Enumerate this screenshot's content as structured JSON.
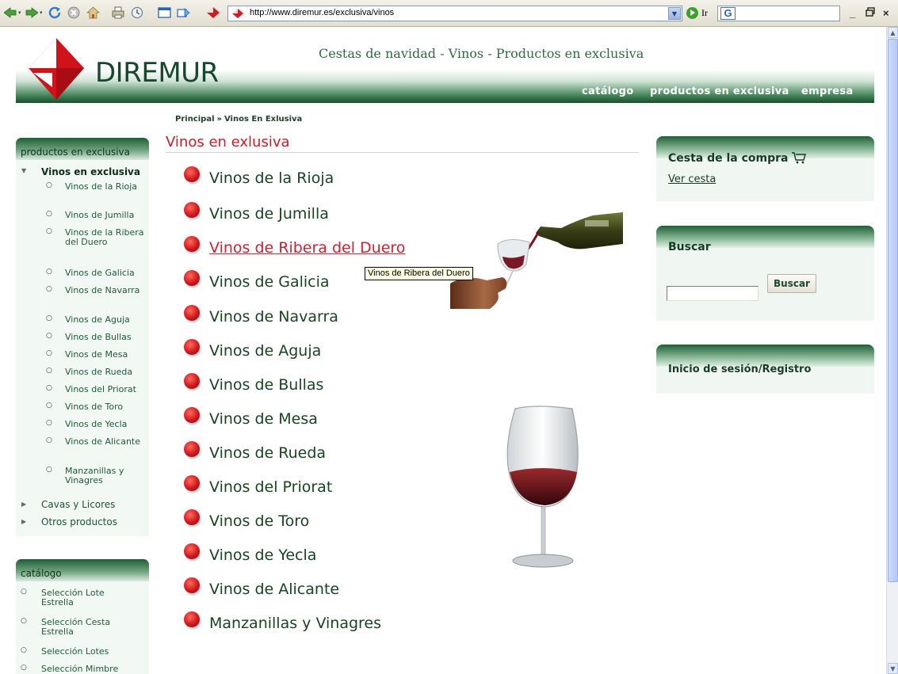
{
  "browser": {
    "url": "http://www.diremur.es/exclusiva/vinos",
    "go_label": "Ir",
    "min_label": "_",
    "restore_label": "ё",
    "close_label": "×"
  },
  "header": {
    "logo_text": "DIREMUR",
    "tagline": "Cestas de navidad - Vinos - Productos en exclusiva",
    "nav": [
      "catálogo",
      "productos en exclusiva",
      "empresa"
    ]
  },
  "breadcrumb": {
    "home": "Principal",
    "separator": "»",
    "current": "Vinos En Exlusiva"
  },
  "page_title": "Vinos en exlusiva",
  "sidebar": {
    "exclusive": {
      "title": "productos en exclusiva",
      "open_label": "Vinos en exclusiva",
      "subitems": [
        "Vinos de la Rioja",
        "Vinos de Jumilla",
        "Vinos de la Ribera del Duero",
        "Vinos de Galicia",
        "Vinos de Navarra",
        "Vinos de Aguja",
        "Vinos de Bullas",
        "Vinos de Mesa",
        "Vinos de Rueda",
        "Vinos del Priorat",
        "Vinos de Toro",
        "Vinos de Yecla",
        "Vinos de Alicante",
        "Manzanillas y Vinagres"
      ],
      "collapsed": [
        "Cavas y Licores",
        "Otros productos"
      ]
    },
    "catalog": {
      "title": "catálogo",
      "items": [
        "Selección Lote Estrella",
        "Selección Cesta Estrella",
        "Selección Lotes",
        "Selección Mimbre"
      ]
    }
  },
  "wines": [
    "Vinos de la Rioja",
    "Vinos de Jumilla",
    "Vinos de Ribera del Duero",
    "Vinos de Galicia",
    "Vinos de Navarra",
    "Vinos de Aguja",
    "Vinos de Bullas",
    "Vinos de Mesa",
    "Vinos de Rueda",
    "Vinos del Priorat",
    "Vinos de Toro",
    "Vinos de Yecla",
    "Vinos de Alicante",
    "Manzanillas y Vinagres"
  ],
  "hovered_index": 2,
  "tooltip": "Vinos de Ribera del Duero",
  "cart": {
    "title": "Cesta de la compra",
    "link": "Ver cesta"
  },
  "search": {
    "title": "Buscar",
    "button": "Buscar",
    "value": ""
  },
  "login": {
    "label": "Inicio de sesión/Registro"
  },
  "colors": {
    "brand_green": "#17512c",
    "accent_red": "#d21a23",
    "link_green": "#17451f"
  }
}
